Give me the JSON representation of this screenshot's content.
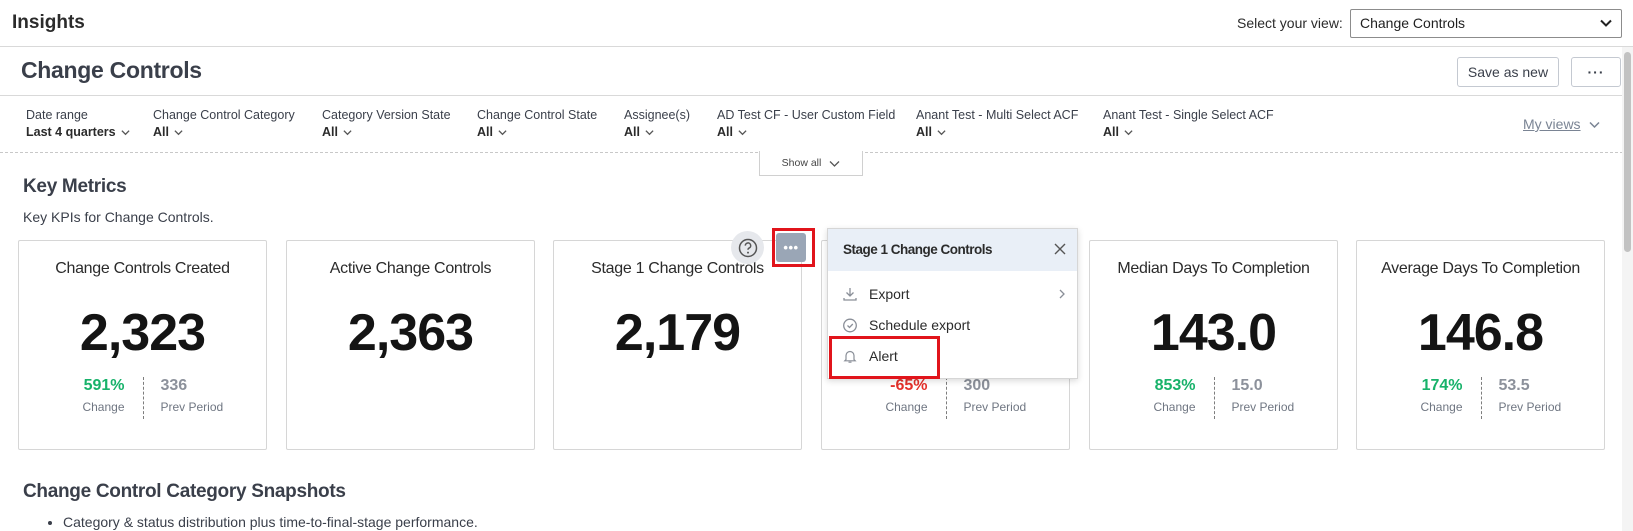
{
  "header": {
    "app_title": "Insights",
    "view_label": "Select your view:",
    "view_selected": "Change Controls"
  },
  "page": {
    "title": "Change Controls",
    "save_as_new": "Save as new",
    "more": "···"
  },
  "filters": [
    {
      "label": "Date range",
      "value": "Last 4 quarters"
    },
    {
      "label": "Change Control Category",
      "value": "All"
    },
    {
      "label": "Category Version State",
      "value": "All"
    },
    {
      "label": "Change Control State",
      "value": "All"
    },
    {
      "label": "Assignee(s)",
      "value": "All"
    },
    {
      "label": "AD Test CF - User Custom Field",
      "value": "All"
    },
    {
      "label": "Anant Test - Multi Select ACF",
      "value": "All"
    },
    {
      "label": "Anant Test - Single Select ACF",
      "value": "All"
    }
  ],
  "my_views": "My views",
  "show_all": "Show all",
  "key_metrics": {
    "title": "Key Metrics",
    "subtitle": "Key KPIs for Change Controls.",
    "cards": [
      {
        "title": "Change Controls Created",
        "value": "2,323",
        "change": "591%",
        "change_label": "Change",
        "prev": "336",
        "prev_label": "Prev Period",
        "trend": "positive"
      },
      {
        "title": "Active Change Controls",
        "value": "2,363"
      },
      {
        "title": "Stage 1 Change Controls",
        "value": "2,179"
      },
      {
        "title": "",
        "value": "",
        "change": "-65%",
        "change_label": "Change",
        "prev": "300",
        "prev_label": "Prev Period",
        "trend": "negative"
      },
      {
        "title": "Median Days To Completion",
        "value": "143.0",
        "change": "853%",
        "change_label": "Change",
        "prev": "15.0",
        "prev_label": "Prev Period",
        "trend": "positive"
      },
      {
        "title": "Average Days To Completion",
        "value": "146.8",
        "change": "174%",
        "change_label": "Change",
        "prev": "53.5",
        "prev_label": "Prev Period",
        "trend": "positive"
      }
    ]
  },
  "popup": {
    "title": "Stage 1 Change Controls",
    "items": [
      {
        "label": "Export",
        "icon": "download-icon",
        "has_submenu": true
      },
      {
        "label": "Schedule export",
        "icon": "clock-icon",
        "has_submenu": false
      },
      {
        "label": "Alert",
        "icon": "bell-icon",
        "has_submenu": false
      }
    ]
  },
  "snapshots": {
    "title": "Change Control Category Snapshots",
    "bullets": [
      "Category & status distribution plus time-to-final-stage performance."
    ]
  },
  "colors": {
    "positive": "#17b26a",
    "negative": "#e5312b",
    "highlight": "#e1141b",
    "popup_header": "#e9eff7"
  }
}
